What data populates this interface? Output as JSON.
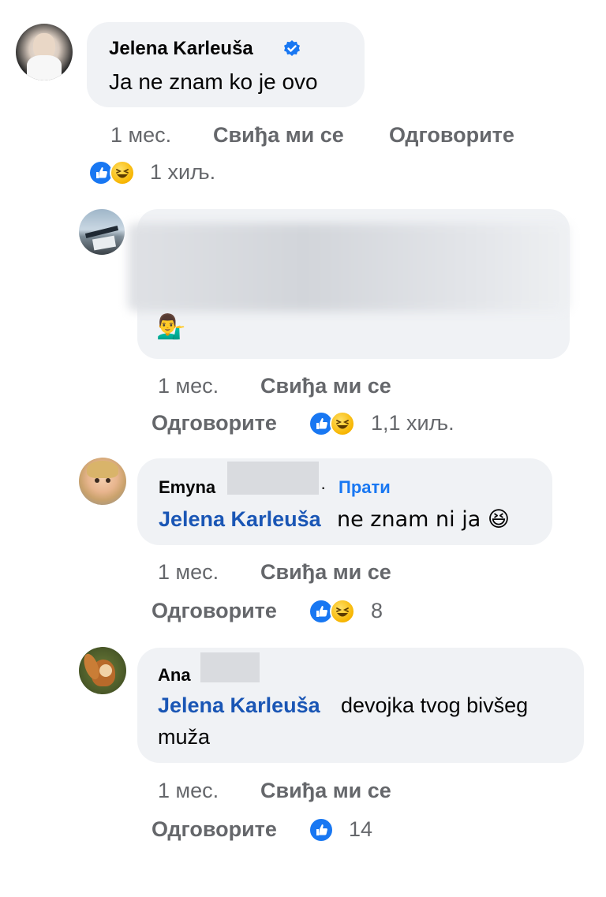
{
  "comments": [
    {
      "author": "Jelena Karleuša",
      "verified": true,
      "text": "Ja ne znam ko je ovo",
      "time": "1 мес.",
      "like_label": "Свиђа ми се",
      "reply_label": "Одговорите",
      "reaction_count": "1 хиљ.",
      "reactions": [
        "like-icon",
        "haha-icon"
      ]
    },
    {
      "author": "",
      "blurred": true,
      "text_emoji": "💁‍♂️",
      "time": "1 мес.",
      "like_label": "Свиђа ми се",
      "reply_label": "Одговорите",
      "reaction_count": "1,1 хиљ.",
      "reactions": [
        "like-icon",
        "haha-icon"
      ]
    },
    {
      "author": "Emyna",
      "follow_label": "Прати",
      "follow_separator": "·",
      "mention": "Jelena Karleuša",
      "text": "ne znam ni ja 😆",
      "time": "1 мес.",
      "like_label": "Свиђа ми се",
      "reply_label": "Одговорите",
      "reaction_count": "8",
      "reactions": [
        "like-icon",
        "haha-icon"
      ]
    },
    {
      "author": "Ana",
      "mention": "Jelena Karleuša",
      "text_line1": "devojka tvog bivšeg",
      "text_line2": "muža",
      "time": "1 мес.",
      "like_label": "Свиђа ми се",
      "reply_label": "Одговорите",
      "reaction_count": "14",
      "reactions": [
        "like-icon"
      ]
    }
  ],
  "colors": {
    "bubble": "#f0f2f5",
    "meta_text": "#65676b",
    "mention": "#1a56b5",
    "like_blue": "#1877f2",
    "verified_blue": "#1877f2"
  }
}
